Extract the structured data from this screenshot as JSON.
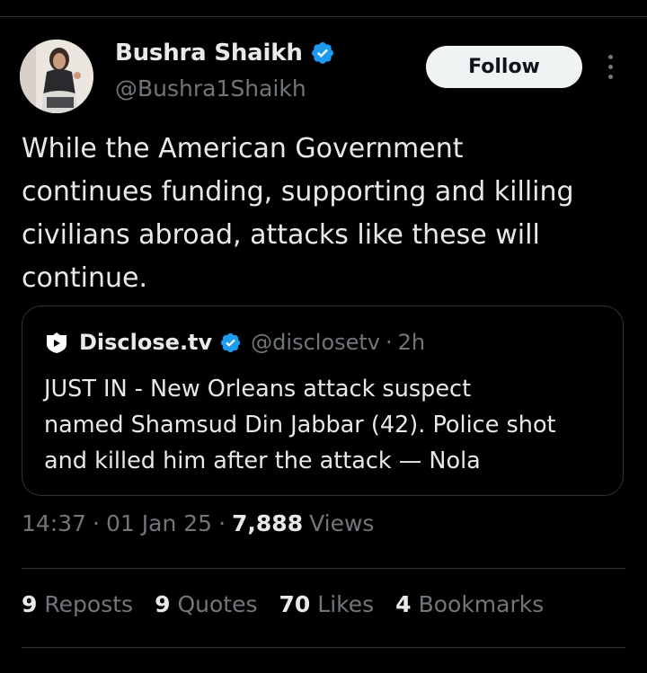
{
  "author": {
    "display_name": "Bushra Shaikh",
    "handle": "@Bushra1Shaikh",
    "verified_icon": "verified-badge-icon",
    "avatar_icon": "avatar"
  },
  "follow_label": "Follow",
  "more_icon": "more-options-icon",
  "tweet": {
    "text": "While the American Government\ncontinues funding, supporting and killing\ncivilians abroad, attacks like these will\ncontinue."
  },
  "quote": {
    "logo_icon": "disclose-tv-logo-icon",
    "name": "Disclose.tv",
    "handle": "@disclosetv",
    "separator": "·",
    "time": "2h",
    "text": "JUST IN - New Orleans attack suspect\nnamed Shamsud Din Jabbar (42). Police shot\nand killed him after the attack — Nola"
  },
  "meta": {
    "time": "14:37",
    "separator": "·",
    "date": "01 Jan 25",
    "views_count": "7,888",
    "views_label": "Views"
  },
  "stats": {
    "reposts_count": "9",
    "reposts_label": "Reposts",
    "quotes_count": "9",
    "quotes_label": "Quotes",
    "likes_count": "70",
    "likes_label": "Likes",
    "bookmarks_count": "4",
    "bookmarks_label": "Bookmarks"
  },
  "colors": {
    "background": "#000000",
    "primary_text": "#e7e9ea",
    "secondary_text": "#71767b",
    "verified_blue": "#1d9bf0",
    "divider": "#2f3336",
    "follow_bg": "#eff3f4"
  }
}
